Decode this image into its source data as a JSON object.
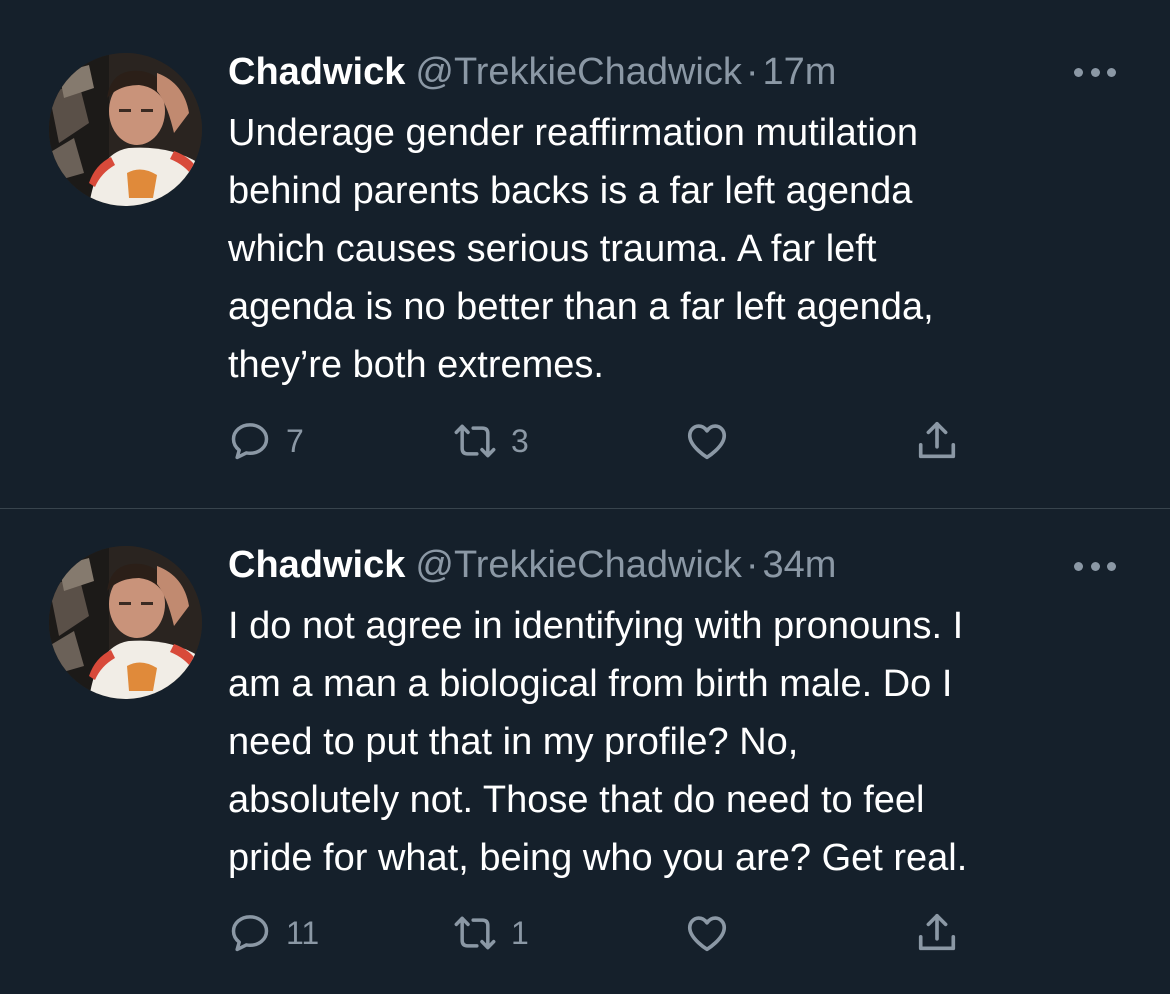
{
  "tweets": [
    {
      "author": {
        "name": "Chadwick",
        "handle": "@TrekkieChadwick",
        "avatar_icon": "profile-photo"
      },
      "separator": "·",
      "time": "17m",
      "text_lines": [
        "Underage gender reaffirmation mutilation",
        "behind parents backs is a far left agenda",
        "which causes serious trauma. A far left",
        "agenda is no better than a far left agenda,",
        "they’re both extremes."
      ],
      "stats": {
        "replies": "7",
        "retweets": "3",
        "likes": "",
        "share": ""
      }
    },
    {
      "author": {
        "name": "Chadwick",
        "handle": "@TrekkieChadwick",
        "avatar_icon": "profile-photo"
      },
      "separator": "·",
      "time": "34m",
      "text_lines": [
        "I do not agree in identifying with pronouns. I",
        "am a man a biological from birth male. Do I",
        "need to put that in my profile? No,",
        "absolutely not. Those that do need to feel",
        "pride for what, being who you are? Get real."
      ],
      "stats": {
        "replies": "11",
        "retweets": "1",
        "likes": "",
        "share": ""
      }
    }
  ],
  "icons": {
    "reply": "reply-icon",
    "retweet": "retweet-icon",
    "like": "heart-icon",
    "share": "share-icon",
    "more": "more-options-icon"
  },
  "colors": {
    "background": "#15202b",
    "text_primary": "#ffffff",
    "text_secondary": "#8b98a5",
    "divider": "#38444d"
  }
}
